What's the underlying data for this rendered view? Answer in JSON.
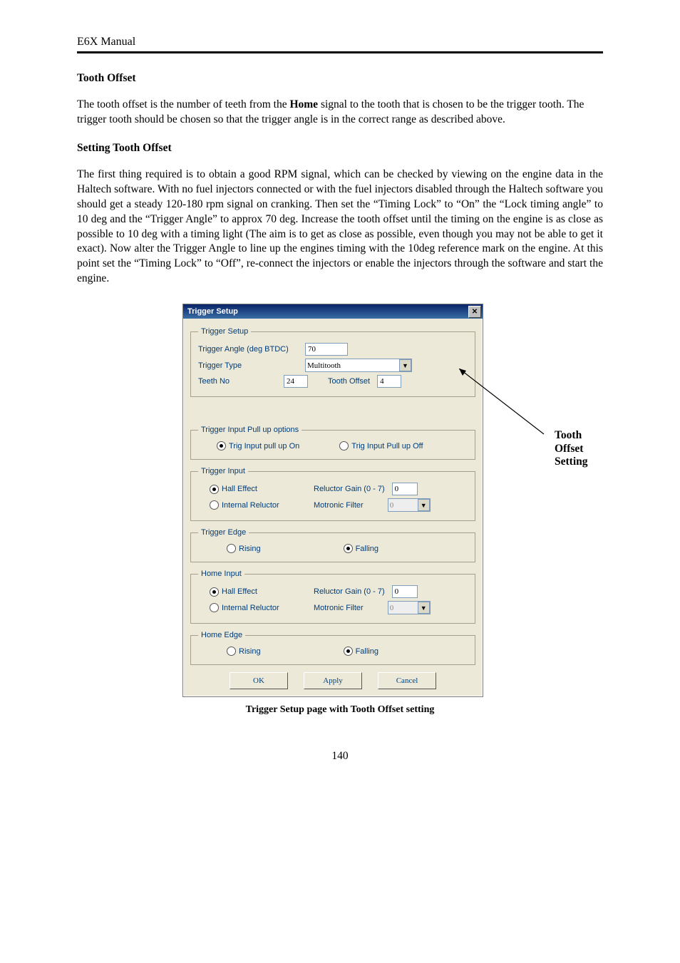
{
  "header": {
    "manual_title": "E6X Manual"
  },
  "section1": {
    "heading": "Tooth Offset",
    "para": "The tooth offset is the number of teeth from the Home signal to the tooth that is chosen to be the trigger tooth. The trigger tooth should be chosen so that the trigger angle is in the correct range as described above."
  },
  "section2": {
    "heading": "Setting Tooth Offset",
    "para": "The first thing required is to obtain a good RPM signal, which can be checked by viewing on the engine data in the Haltech software. With no fuel injectors connected or with the fuel injectors disabled through the Haltech software you should get a steady 120-180 rpm signal on cranking. Then set the “Timing Lock” to “On” the “Lock timing angle” to 10 deg and the “Trigger Angle” to approx 70 deg. Increase the tooth offset until the timing on the engine is as close as possible to 10 deg with a timing light (The aim is to get as close as possible, even though you may not be able to get it exact). Now alter the Trigger Angle to line up the engines timing with the 10deg reference mark on the engine. At this point set the “Timing Lock” to “Off”, re-connect the injectors or enable the injectors through the software and start the engine."
  },
  "dialog": {
    "title": "Trigger Setup",
    "setup": {
      "legend": "Trigger Setup",
      "trigger_angle_label": "Trigger Angle (deg BTDC)",
      "trigger_angle_value": "70",
      "trigger_type_label": "Trigger Type",
      "trigger_type_value": "Multitooth",
      "teeth_no_label": "Teeth No",
      "teeth_no_value": "24",
      "tooth_offset_label": "Tooth Offset",
      "tooth_offset_value": "4"
    },
    "pullup": {
      "legend": "Trigger Input Pull up options",
      "on": "Trig Input pull up On",
      "off": "Trig Input Pull up Off"
    },
    "trigger_input": {
      "legend": "Trigger Input",
      "hall": "Hall Effect",
      "internal": "Internal Reluctor",
      "gain_label": "Reluctor Gain (0 - 7)",
      "gain_value": "0",
      "filter_label": "Motronic Filter",
      "filter_value": "0"
    },
    "trigger_edge": {
      "legend": "Trigger Edge",
      "rising": "Rising",
      "falling": "Falling"
    },
    "home_input": {
      "legend": "Home Input",
      "hall": "Hall Effect",
      "internal": "Internal Reluctor",
      "gain_label": "Reluctor Gain (0 - 7)",
      "gain_value": "0",
      "filter_label": "Motronic Filter",
      "filter_value": "0"
    },
    "home_edge": {
      "legend": "Home Edge",
      "rising": "Rising",
      "falling": "Falling"
    },
    "buttons": {
      "ok": "OK",
      "apply": "Apply",
      "cancel": "Cancel"
    }
  },
  "callout": {
    "line1": "Tooth",
    "line2": "Offset",
    "line3": "Setting"
  },
  "caption": "Trigger Setup page with Tooth Offset setting",
  "page_number": "140",
  "bold_home": "Home"
}
